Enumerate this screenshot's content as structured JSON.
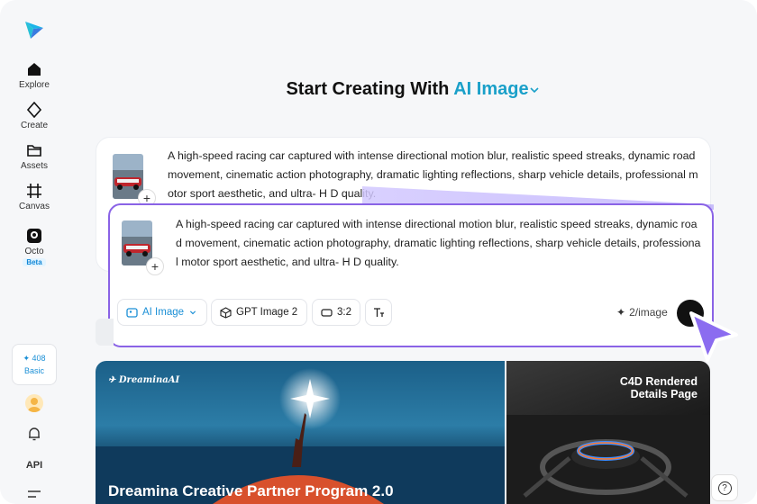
{
  "sidebar": {
    "items": [
      {
        "label": "Explore",
        "icon": "home-icon"
      },
      {
        "label": "Create",
        "icon": "sparkle-diamond-icon"
      },
      {
        "label": "Assets",
        "icon": "folder-icon"
      },
      {
        "label": "Canvas",
        "icon": "canvas-frame-icon"
      },
      {
        "label": "Octo",
        "icon": "octo-icon"
      }
    ],
    "octo_badge": "Beta",
    "credits": {
      "value": "408",
      "plan": "Basic"
    },
    "api_label": "API"
  },
  "header": {
    "title_prefix": "Start Creating With",
    "title_accent": "AI Image"
  },
  "prompt": {
    "back_text": "A high-speed racing car captured with intense directional motion blur, realistic speed streaks, dynamic road movement, cinematic action photography, dramatic lighting reflections, sharp vehicle details, professional motor sport aesthetic, and ultra- H D quality.",
    "front_text": "A high-speed racing car captured with intense directional motion blur, realistic speed streaks, dynamic road movement, cinematic action photography, dramatic lighting reflections, sharp vehicle details, professional motor sport aesthetic, and ultra- H D quality.",
    "add_reference": "+"
  },
  "toolbar": {
    "mode": "AI Image",
    "model": "GPT Image 2",
    "ratio": "3:2",
    "cost": "2/image"
  },
  "banners": [
    {
      "brand": "DreaminaAI",
      "title": "Dreamina Creative Partner Program 2.0"
    },
    {
      "title_line1": "C4D Rendered",
      "title_line2": "Details Page"
    }
  ],
  "help": "?",
  "colors": {
    "accent": "#1aa0c9",
    "focus": "#8a63e6"
  }
}
